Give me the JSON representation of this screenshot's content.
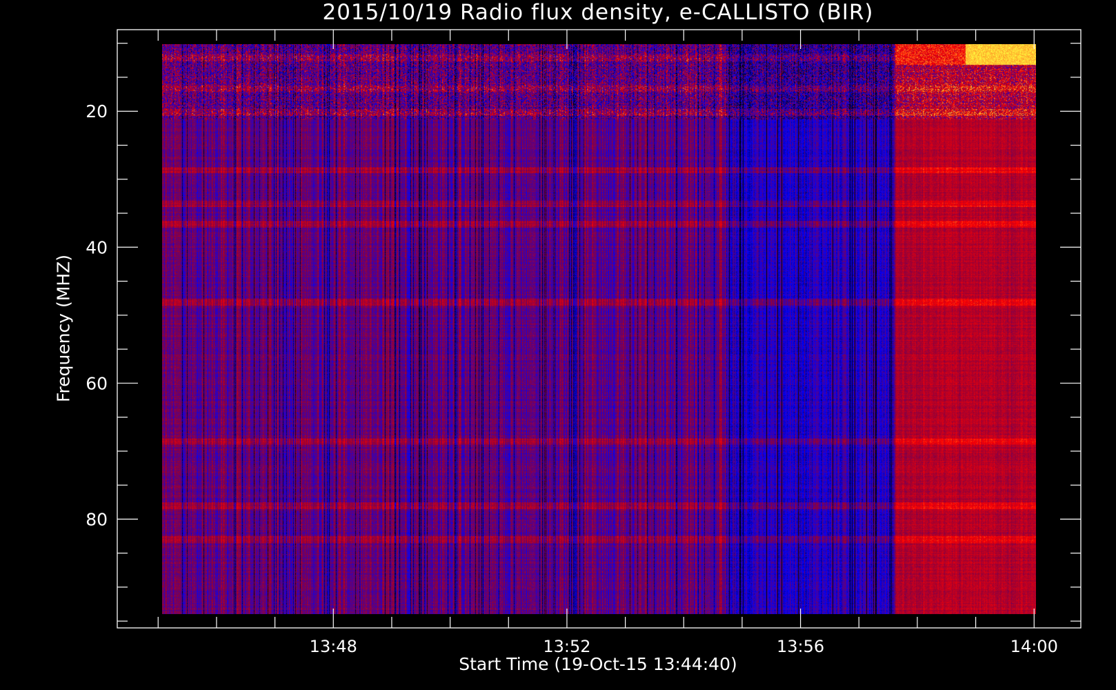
{
  "chart_data": {
    "type": "heatmap",
    "title": "2015/10/19  Radio flux density, e-CALLISTO (BIR)",
    "xlabel": "Start Time (19-Oct-15 13:44:40)",
    "ylabel": "Frequency (MHZ)",
    "x_ticks": [
      {
        "minutes": 228,
        "label": "13:48"
      },
      {
        "minutes": 232,
        "label": "13:52"
      },
      {
        "minutes": 236,
        "label": "13:56"
      },
      {
        "minutes": 240,
        "label": "14:00"
      }
    ],
    "x_minor_step_minutes": 1,
    "xlim_minutes_after_1100": [
      224.3,
      240.8
    ],
    "data_time_range_minutes": [
      225.1,
      240.0
    ],
    "y_ticks": [
      20,
      40,
      60,
      80
    ],
    "y_minor_step": 5,
    "ylim": [
      96,
      8
    ],
    "data_freq_range_mhz": [
      10,
      94
    ],
    "colormap": [
      "#000000",
      "#0000ff",
      "#8c003c",
      "#ff0000",
      "#ffff40"
    ],
    "notable_bands_mhz": [
      12,
      16.5,
      20,
      28.5,
      33.5,
      36.5,
      48,
      68.5,
      78,
      83
    ],
    "notable_features": {
      "bright_top_right_mhz": [
        10,
        13
      ],
      "dark_interval_minutes": [
        234.7,
        237.6
      ],
      "enhanced_red_interval_minutes": [
        237.6,
        240.0
      ]
    }
  }
}
